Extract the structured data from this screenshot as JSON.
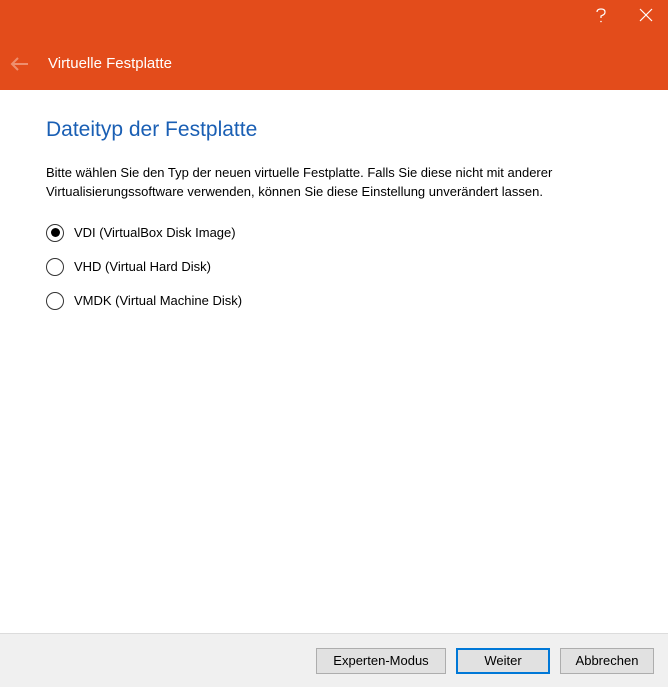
{
  "titlebar": {
    "title": "Virtuelle Festplatte"
  },
  "content": {
    "heading": "Dateityp der Festplatte",
    "description": "Bitte wählen Sie den Typ der neuen virtuelle Festplatte. Falls Sie diese nicht mit anderer Virtualisierungssoftware verwenden, können Sie diese Einstellung unverändert lassen.",
    "options": [
      {
        "label": "VDI (VirtualBox Disk Image)",
        "selected": true
      },
      {
        "label": "VHD (Virtual Hard Disk)",
        "selected": false
      },
      {
        "label": "VMDK (Virtual Machine Disk)",
        "selected": false
      }
    ]
  },
  "footer": {
    "expert_label": "Experten-Modus",
    "next_label": "Weiter",
    "cancel_label": "Abbrechen"
  }
}
